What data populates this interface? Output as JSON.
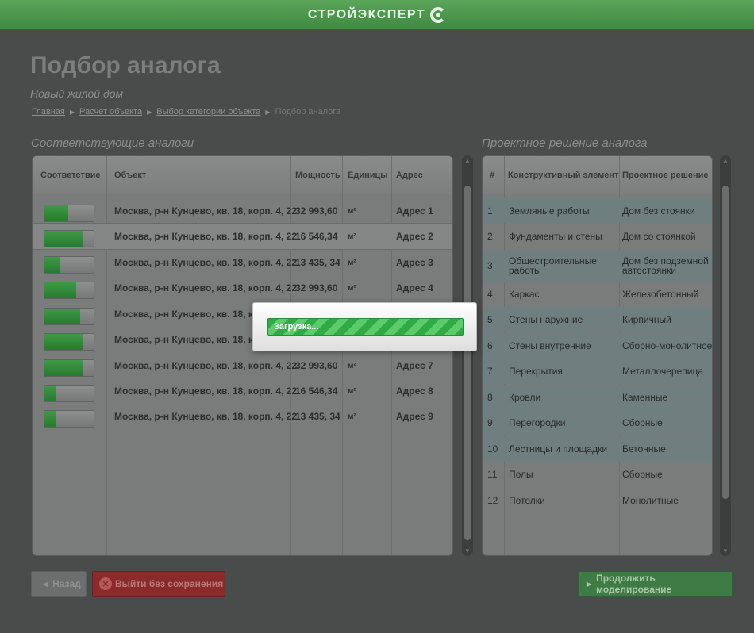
{
  "header": {
    "brand": "СТРОЙЭКСПЕРТ"
  },
  "page": {
    "title": "Подбор аналога",
    "subtitle": "Новый жилой дом",
    "breadcrumb": [
      "Главная",
      "Расчет объекта",
      "Выбор категории объекта",
      "Подбор аналога"
    ]
  },
  "analogs": {
    "title": "Соответствующие аналоги",
    "columns": [
      "Соответствие",
      "Объект",
      "Мощность",
      "Единицы",
      "Адрес"
    ],
    "rows": [
      {
        "match": 0.48,
        "object": "Москва, р-н Кунцево, кв. 18, корп. 4, 22",
        "power": "32 993,60",
        "unit": "м²",
        "address": "Адрес 1"
      },
      {
        "match": 0.78,
        "object": "Москва, р-н Кунцево, кв. 18, корп. 4, 22",
        "power": "16 546,34",
        "unit": "м²",
        "address": "Адрес 2"
      },
      {
        "match": 0.3,
        "object": "Москва, р-н Кунцево, кв. 18, корп. 4, 22",
        "power": "13 435, 34",
        "unit": "м²",
        "address": "Адрес 3"
      },
      {
        "match": 0.65,
        "object": "Москва, р-н Кунцево, кв. 18, корп. 4, 22",
        "power": "32 993,60",
        "unit": "м²",
        "address": "Адрес 4"
      },
      {
        "match": 0.72,
        "object": "Москва, р-н Кунцево, кв. 18, корп",
        "power": "",
        "unit": "",
        "address": ""
      },
      {
        "match": 0.78,
        "object": "Москва, р-н Кунцево, кв. 18, корп",
        "power": "",
        "unit": "",
        "address": ""
      },
      {
        "match": 0.78,
        "object": "Москва, р-н Кунцево, кв. 18, корп. 4, 22",
        "power": "32 993,60",
        "unit": "м²",
        "address": "Адрес 7"
      },
      {
        "match": 0.22,
        "object": "Москва, р-н Кунцево, кв. 18, корп. 4, 22",
        "power": "16 546,34",
        "unit": "м²",
        "address": "Адрес 8"
      },
      {
        "match": 0.22,
        "object": "Москва, р-н Кунцево, кв. 18, корп. 4, 22",
        "power": "13 435, 34",
        "unit": "м²",
        "address": "Адрес 9"
      }
    ]
  },
  "solution": {
    "title": "Проектное решение аналога",
    "columns": [
      "#",
      "Конструктивный элемент",
      "Проектное решение"
    ],
    "rows": [
      {
        "num": "1",
        "element": "Земляные работы",
        "decision": "Дом без стоянки"
      },
      {
        "num": "2",
        "element": "Фундаменты и стены",
        "decision": "Дом со стоянкой"
      },
      {
        "num": "3",
        "element": "Общестроительные работы",
        "decision": "Дом без подземной автостоянки"
      },
      {
        "num": "4",
        "element": "Каркас",
        "decision": "Железобетонный"
      },
      {
        "num": "5",
        "element": "Стены наружние",
        "decision": "Кирпичный"
      },
      {
        "num": "6",
        "element": "Стены внутренние",
        "decision": "Сборно-монолитное"
      },
      {
        "num": "7",
        "element": "Перекрытия",
        "decision": "Металлочерепица"
      },
      {
        "num": "8",
        "element": "Кровли",
        "decision": "Каменные"
      },
      {
        "num": "9",
        "element": "Перегородки",
        "decision": "Сборные"
      },
      {
        "num": "10",
        "element": "Лестницы и площадки",
        "decision": "Бетонные"
      },
      {
        "num": "11",
        "element": "Полы",
        "decision": "Сборные"
      },
      {
        "num": "12",
        "element": "Потолки",
        "decision": "Монолитные"
      }
    ]
  },
  "buttons": {
    "back": "Назад",
    "exit": "Выйти без сохранения",
    "next": "Продолжить моделирование"
  },
  "modal": {
    "loading_text": "Загрузка..."
  },
  "colors": {
    "brand_green": "#3f8a40",
    "exit_red": "#8b2a2a",
    "progress_green": "#2faa45"
  }
}
